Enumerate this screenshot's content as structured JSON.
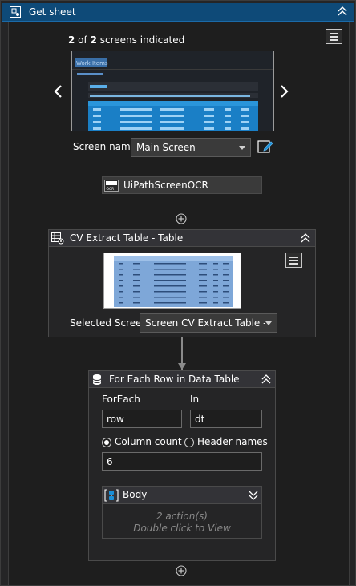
{
  "window": {
    "title": "Get sheet",
    "title_icon": "screen-scope-icon",
    "collapse_icon": "double-chevron-up-icon"
  },
  "screen_selector": {
    "count_current": "2",
    "count_middle": " of ",
    "count_total": "2",
    "count_suffix": " screens indicated",
    "prev_icon": "chevron-left-icon",
    "next_icon": "chevron-right-icon",
    "menu_icon": "hamburger-menu-icon",
    "preview_title": "Work Items",
    "screen_name_label": "Screen name",
    "screen_name_value": "Main Screen",
    "edit_icon": "edit-pencil-icon"
  },
  "ocr_engine": {
    "label": "UiPathScreenOCR",
    "icon_label": "OCR"
  },
  "cv_extract": {
    "title": "CV Extract Table - Table",
    "selected_screen_label": "Selected Screen",
    "selected_screen_value": "Screen CV Extract Table - Table"
  },
  "for_each": {
    "title": "For Each Row in Data Table",
    "foreach_label": "ForEach",
    "foreach_value": "row",
    "in_label": "In",
    "in_value": "dt",
    "option_column_count": "Column count",
    "option_header_names": "Header names",
    "selected_option": "Column count",
    "column_count_value": "6",
    "body": {
      "title": "Body",
      "actions": "2 action(s)",
      "hint": "Double click to View"
    }
  },
  "colors": {
    "title_bar": "#0e4a78",
    "panel_bg": "#1e1e1e",
    "header_bg": "#333337",
    "accent_blue": "#1a8fd6"
  }
}
